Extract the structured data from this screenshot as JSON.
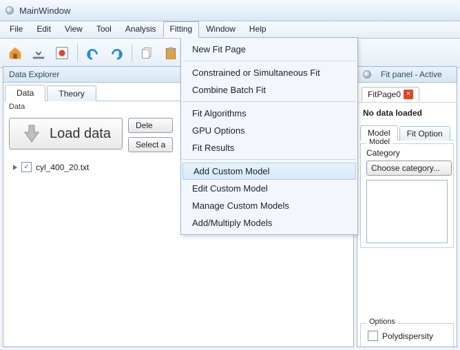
{
  "window": {
    "title": "MainWindow"
  },
  "menubar": [
    "File",
    "Edit",
    "View",
    "Tool",
    "Analysis",
    "Fitting",
    "Window",
    "Help"
  ],
  "menubar_open_index": 5,
  "dropdown": {
    "groups": [
      [
        "New Fit Page"
      ],
      [
        "Constrained or Simultaneous Fit",
        "Combine Batch Fit"
      ],
      [
        "Fit Algorithms",
        "GPU Options",
        "Fit Results"
      ],
      [
        "Add Custom Model",
        "Edit Custom Model",
        "Manage Custom Models",
        "Add/Multiply Models"
      ]
    ],
    "highlighted": "Add Custom Model"
  },
  "data_explorer": {
    "title": "Data Explorer",
    "tabs": [
      "Data",
      "Theory"
    ],
    "active_tab": 0,
    "subhead": "Data",
    "load_label": "Load data",
    "delete_btn": "Dele",
    "select_btn": "Select a",
    "items": [
      {
        "name": "cyl_400_20.txt",
        "checked": true
      }
    ]
  },
  "fit_panel": {
    "title": "Fit panel - Active ",
    "tab": "FitPage0",
    "status": "No data loaded",
    "inner_tabs": [
      "Model",
      "Fit Option"
    ],
    "active_inner": 0,
    "model_group": "Model",
    "category_label": "Category",
    "category_select": "Choose category...",
    "options_group": "Options",
    "poly_label": "Polydispersity"
  }
}
